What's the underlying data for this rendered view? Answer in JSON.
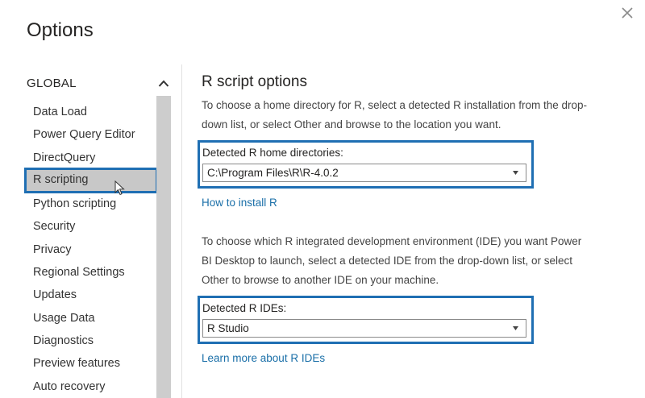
{
  "dialog": {
    "title": "Options"
  },
  "sidebar": {
    "heading": "GLOBAL",
    "items": [
      {
        "label": "Data Load"
      },
      {
        "label": "Power Query Editor"
      },
      {
        "label": "DirectQuery"
      },
      {
        "label": "R scripting"
      },
      {
        "label": "Python scripting"
      },
      {
        "label": "Security"
      },
      {
        "label": "Privacy"
      },
      {
        "label": "Regional Settings"
      },
      {
        "label": "Updates"
      },
      {
        "label": "Usage Data"
      },
      {
        "label": "Diagnostics"
      },
      {
        "label": "Preview features"
      },
      {
        "label": "Auto recovery"
      }
    ],
    "selected_label": "R scripting"
  },
  "main": {
    "title": "R script options",
    "home_intro": "To choose a home directory for R, select a detected R installation from the drop-down list, or select Other and browse to the location you want.",
    "home_label": "Detected R home directories:",
    "home_value": "C:\\Program Files\\R\\R-4.0.2",
    "install_link": "How to install R",
    "ide_intro": "To choose which R integrated development environment (IDE) you want Power BI Desktop to launch, select a detected IDE from the drop-down list, or select Other to browse to another IDE on your machine.",
    "ide_label": "Detected R IDEs:",
    "ide_value": "R Studio",
    "ide_link": "Learn more about R IDEs"
  },
  "colors": {
    "highlight_border": "#1f6fb3",
    "link": "#1a6fa8",
    "selected_bg": "#c8c8c8"
  },
  "icons": {
    "close": "close-icon",
    "scroll_up": "chevron-up-icon",
    "dropdown": "caret-down-icon",
    "cursor": "mouse-pointer-icon"
  }
}
